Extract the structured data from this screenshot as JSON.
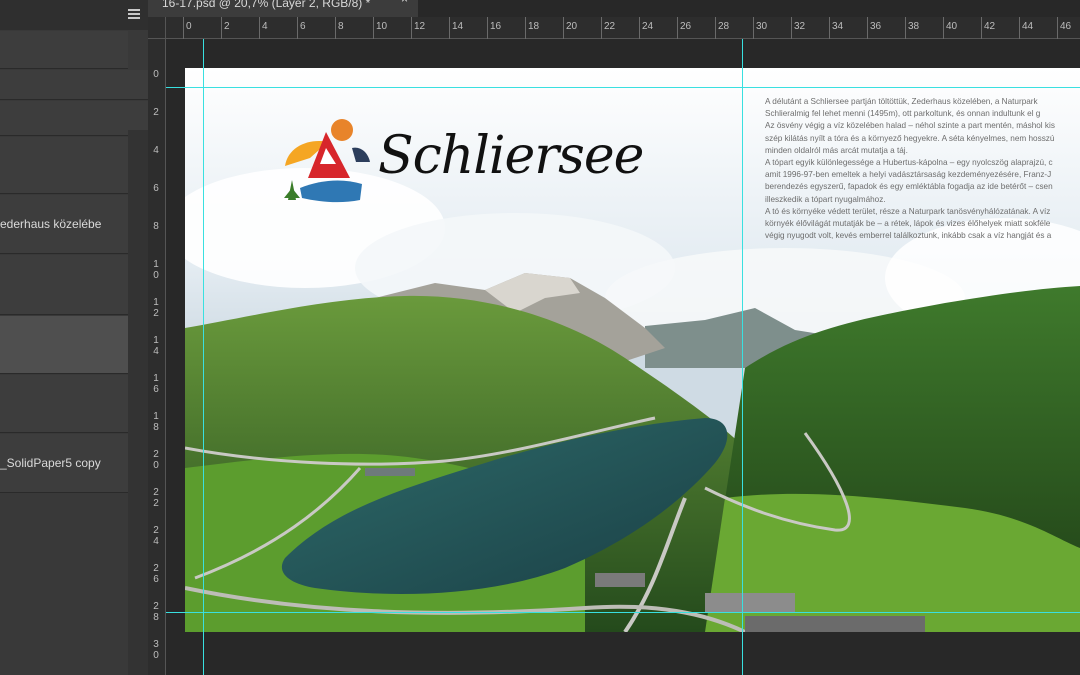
{
  "document": {
    "tab_title": "16-17.psd @ 20,7% (Layer 2, RGB/8) *",
    "close_glyph": "×"
  },
  "layers": {
    "items": [
      {
        "label": ""
      },
      {
        "label": ""
      },
      {
        "label": ""
      },
      {
        "label": ""
      },
      {
        "label": "ederhaus közelébe"
      },
      {
        "label": ""
      },
      {
        "label": ""
      },
      {
        "label": ""
      },
      {
        "label": "_SolidPaper5 copy"
      }
    ]
  },
  "rulers": {
    "top_ticks": [
      "0",
      "2",
      "4",
      "6",
      "8",
      "10",
      "12",
      "14",
      "16",
      "18",
      "20",
      "22",
      "24",
      "26",
      "28",
      "30",
      "32",
      "34",
      "36",
      "38",
      "40",
      "42",
      "44",
      "46"
    ],
    "left_ticks": [
      "0",
      "2",
      "4",
      "6",
      "8",
      "10",
      "12",
      "14",
      "16",
      "18",
      "20",
      "22",
      "24",
      "26",
      "28",
      "30"
    ]
  },
  "page": {
    "logo_text": "Schliersee",
    "article_lines": [
      "A délutánt a Schliersee partján töltöttük, Zederhaus közelében, a Naturpark",
      "Schlieralmig fel lehet menni (1495m), ott parkoltunk, és onnan indultunk el g",
      "Az ösvény végig a víz közelében halad – néhol szinte a part mentén, máshol kis",
      "szép kilátás nyílt a tóra és a környező hegyekre. A séta kényelmes, nem hosszú",
      "minden oldalról más arcát mutatja a táj.",
      "A tópart egyik különlegessége a Hubertus-kápolna – egy nyolcszög alaprajzú, c",
      "amit 1996-97-ben emeltek a helyi vadásztársaság kezdeményezésére, Franz-J",
      "berendezés egyszerű, fapadok és egy emléktábla fogadja az ide betérőt – csen",
      "illeszkedik a tópart nyugalmához.",
      "A tó és környéke védett terület, része a Naturpark tanösvényhálózatának. A víz",
      "környék élővilágát mutatják be – a rétek, lápok és vizes élőhelyek miatt sokféle",
      "végig nyugodt volt, kevés emberrel találkoztunk, inkább csak a víz hangját és a"
    ]
  },
  "colors": {
    "guide": "#39e0e0",
    "panel": "#393939",
    "workspace": "#282828"
  }
}
